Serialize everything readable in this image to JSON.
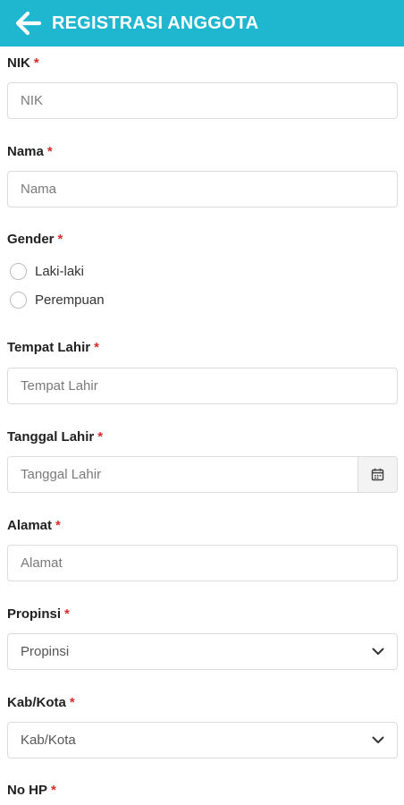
{
  "header": {
    "title": "REGISTRASI ANGGOTA",
    "back_icon": "arrow-left-icon",
    "color": "#1eb7cf"
  },
  "form": {
    "required_marker": "*",
    "nik": {
      "label": "NIK",
      "placeholder": "NIK",
      "value": ""
    },
    "nama": {
      "label": "Nama",
      "placeholder": "Nama",
      "value": ""
    },
    "gender": {
      "label": "Gender",
      "options": [
        "Laki-laki",
        "Perempuan"
      ],
      "selected": null
    },
    "tempat_lahir": {
      "label": "Tempat Lahir",
      "placeholder": "Tempat Lahir",
      "value": ""
    },
    "tanggal_lahir": {
      "label": "Tanggal Lahir",
      "placeholder": "Tanggal Lahir",
      "value": "",
      "icon": "calendar-icon"
    },
    "alamat": {
      "label": "Alamat",
      "placeholder": "Alamat",
      "value": ""
    },
    "propinsi": {
      "label": "Propinsi",
      "selected": "Propinsi",
      "icon": "chevron-down-icon"
    },
    "kab_kota": {
      "label": "Kab/Kota",
      "selected": "Kab/Kota",
      "icon": "chevron-down-icon"
    },
    "no_hp": {
      "label": "No HP"
    }
  }
}
